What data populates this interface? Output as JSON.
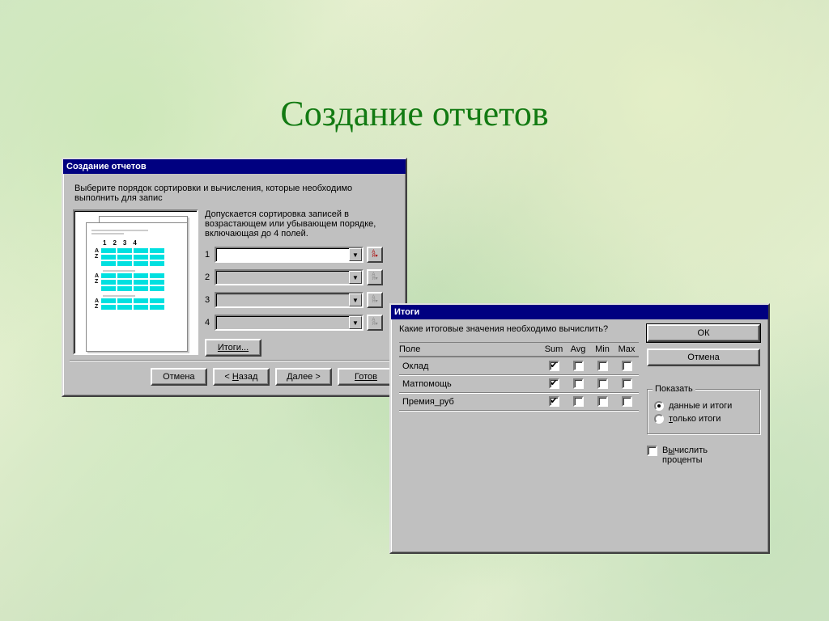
{
  "slide": {
    "title": "Создание отчетов"
  },
  "wizard": {
    "title": "Создание отчетов",
    "instruction": "Выберите порядок сортировки и вычисления, которые необходимо выполнить для запис",
    "description": "Допускается сортировка записей в возрастающем или убывающем порядке, включающая до 4 полей.",
    "preview_cols": [
      "1",
      "2",
      "3",
      "4"
    ],
    "sort_rows": [
      "1",
      "2",
      "3",
      "4"
    ],
    "buttons": {
      "summary": "Итоги...",
      "cancel": "Отмена",
      "back": "< Назад",
      "next": "Далее >",
      "finish": "Готов"
    }
  },
  "summary": {
    "title": "Итоги",
    "prompt": "Какие итоговые значения необходимо вычислить?",
    "headers": {
      "field": "Поле",
      "sum": "Sum",
      "avg": "Avg",
      "min": "Min",
      "max": "Max"
    },
    "rows": [
      {
        "name": "Оклад",
        "sum": true,
        "avg": false,
        "min": false,
        "max": false
      },
      {
        "name": "Матпомощь",
        "sum": true,
        "avg": false,
        "min": false,
        "max": false
      },
      {
        "name": "Премия_руб",
        "sum": true,
        "avg": false,
        "min": false,
        "max": false
      }
    ],
    "ok": "ОК",
    "cancel": "Отмена",
    "show_group": {
      "legend": "Показать",
      "opt_data": "данные и итоги",
      "opt_only": "только итоги",
      "selected": "data"
    },
    "percent_label": "Вычислить проценты"
  }
}
